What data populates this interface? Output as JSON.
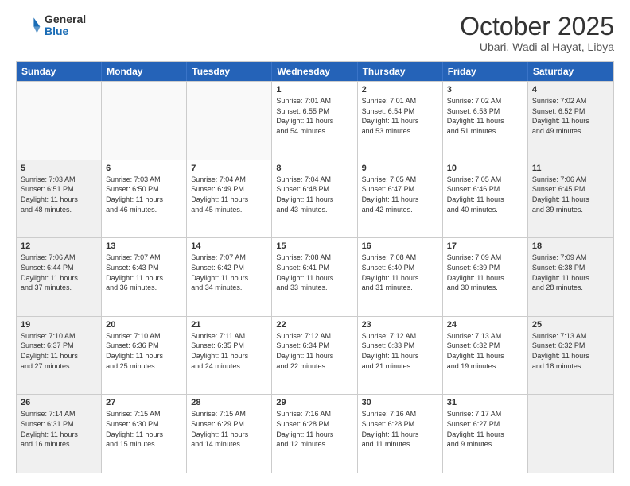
{
  "header": {
    "logo_general": "General",
    "logo_blue": "Blue",
    "title": "October 2025",
    "location": "Ubari, Wadi al Hayat, Libya"
  },
  "weekdays": [
    "Sunday",
    "Monday",
    "Tuesday",
    "Wednesday",
    "Thursday",
    "Friday",
    "Saturday"
  ],
  "rows": [
    [
      {
        "day": "",
        "info": "",
        "empty": true
      },
      {
        "day": "",
        "info": "",
        "empty": true
      },
      {
        "day": "",
        "info": "",
        "empty": true
      },
      {
        "day": "1",
        "info": "Sunrise: 7:01 AM\nSunset: 6:55 PM\nDaylight: 11 hours\nand 54 minutes.",
        "empty": false
      },
      {
        "day": "2",
        "info": "Sunrise: 7:01 AM\nSunset: 6:54 PM\nDaylight: 11 hours\nand 53 minutes.",
        "empty": false
      },
      {
        "day": "3",
        "info": "Sunrise: 7:02 AM\nSunset: 6:53 PM\nDaylight: 11 hours\nand 51 minutes.",
        "empty": false
      },
      {
        "day": "4",
        "info": "Sunrise: 7:02 AM\nSunset: 6:52 PM\nDaylight: 11 hours\nand 49 minutes.",
        "empty": false,
        "shaded": true
      }
    ],
    [
      {
        "day": "5",
        "info": "Sunrise: 7:03 AM\nSunset: 6:51 PM\nDaylight: 11 hours\nand 48 minutes.",
        "empty": false,
        "shaded": true
      },
      {
        "day": "6",
        "info": "Sunrise: 7:03 AM\nSunset: 6:50 PM\nDaylight: 11 hours\nand 46 minutes.",
        "empty": false
      },
      {
        "day": "7",
        "info": "Sunrise: 7:04 AM\nSunset: 6:49 PM\nDaylight: 11 hours\nand 45 minutes.",
        "empty": false
      },
      {
        "day": "8",
        "info": "Sunrise: 7:04 AM\nSunset: 6:48 PM\nDaylight: 11 hours\nand 43 minutes.",
        "empty": false
      },
      {
        "day": "9",
        "info": "Sunrise: 7:05 AM\nSunset: 6:47 PM\nDaylight: 11 hours\nand 42 minutes.",
        "empty": false
      },
      {
        "day": "10",
        "info": "Sunrise: 7:05 AM\nSunset: 6:46 PM\nDaylight: 11 hours\nand 40 minutes.",
        "empty": false
      },
      {
        "day": "11",
        "info": "Sunrise: 7:06 AM\nSunset: 6:45 PM\nDaylight: 11 hours\nand 39 minutes.",
        "empty": false,
        "shaded": true
      }
    ],
    [
      {
        "day": "12",
        "info": "Sunrise: 7:06 AM\nSunset: 6:44 PM\nDaylight: 11 hours\nand 37 minutes.",
        "empty": false,
        "shaded": true
      },
      {
        "day": "13",
        "info": "Sunrise: 7:07 AM\nSunset: 6:43 PM\nDaylight: 11 hours\nand 36 minutes.",
        "empty": false
      },
      {
        "day": "14",
        "info": "Sunrise: 7:07 AM\nSunset: 6:42 PM\nDaylight: 11 hours\nand 34 minutes.",
        "empty": false
      },
      {
        "day": "15",
        "info": "Sunrise: 7:08 AM\nSunset: 6:41 PM\nDaylight: 11 hours\nand 33 minutes.",
        "empty": false
      },
      {
        "day": "16",
        "info": "Sunrise: 7:08 AM\nSunset: 6:40 PM\nDaylight: 11 hours\nand 31 minutes.",
        "empty": false
      },
      {
        "day": "17",
        "info": "Sunrise: 7:09 AM\nSunset: 6:39 PM\nDaylight: 11 hours\nand 30 minutes.",
        "empty": false
      },
      {
        "day": "18",
        "info": "Sunrise: 7:09 AM\nSunset: 6:38 PM\nDaylight: 11 hours\nand 28 minutes.",
        "empty": false,
        "shaded": true
      }
    ],
    [
      {
        "day": "19",
        "info": "Sunrise: 7:10 AM\nSunset: 6:37 PM\nDaylight: 11 hours\nand 27 minutes.",
        "empty": false,
        "shaded": true
      },
      {
        "day": "20",
        "info": "Sunrise: 7:10 AM\nSunset: 6:36 PM\nDaylight: 11 hours\nand 25 minutes.",
        "empty": false
      },
      {
        "day": "21",
        "info": "Sunrise: 7:11 AM\nSunset: 6:35 PM\nDaylight: 11 hours\nand 24 minutes.",
        "empty": false
      },
      {
        "day": "22",
        "info": "Sunrise: 7:12 AM\nSunset: 6:34 PM\nDaylight: 11 hours\nand 22 minutes.",
        "empty": false
      },
      {
        "day": "23",
        "info": "Sunrise: 7:12 AM\nSunset: 6:33 PM\nDaylight: 11 hours\nand 21 minutes.",
        "empty": false
      },
      {
        "day": "24",
        "info": "Sunrise: 7:13 AM\nSunset: 6:32 PM\nDaylight: 11 hours\nand 19 minutes.",
        "empty": false
      },
      {
        "day": "25",
        "info": "Sunrise: 7:13 AM\nSunset: 6:32 PM\nDaylight: 11 hours\nand 18 minutes.",
        "empty": false,
        "shaded": true
      }
    ],
    [
      {
        "day": "26",
        "info": "Sunrise: 7:14 AM\nSunset: 6:31 PM\nDaylight: 11 hours\nand 16 minutes.",
        "empty": false,
        "shaded": true
      },
      {
        "day": "27",
        "info": "Sunrise: 7:15 AM\nSunset: 6:30 PM\nDaylight: 11 hours\nand 15 minutes.",
        "empty": false
      },
      {
        "day": "28",
        "info": "Sunrise: 7:15 AM\nSunset: 6:29 PM\nDaylight: 11 hours\nand 14 minutes.",
        "empty": false
      },
      {
        "day": "29",
        "info": "Sunrise: 7:16 AM\nSunset: 6:28 PM\nDaylight: 11 hours\nand 12 minutes.",
        "empty": false
      },
      {
        "day": "30",
        "info": "Sunrise: 7:16 AM\nSunset: 6:28 PM\nDaylight: 11 hours\nand 11 minutes.",
        "empty": false
      },
      {
        "day": "31",
        "info": "Sunrise: 7:17 AM\nSunset: 6:27 PM\nDaylight: 11 hours\nand 9 minutes.",
        "empty": false
      },
      {
        "day": "",
        "info": "",
        "empty": true,
        "shaded": true
      }
    ]
  ]
}
